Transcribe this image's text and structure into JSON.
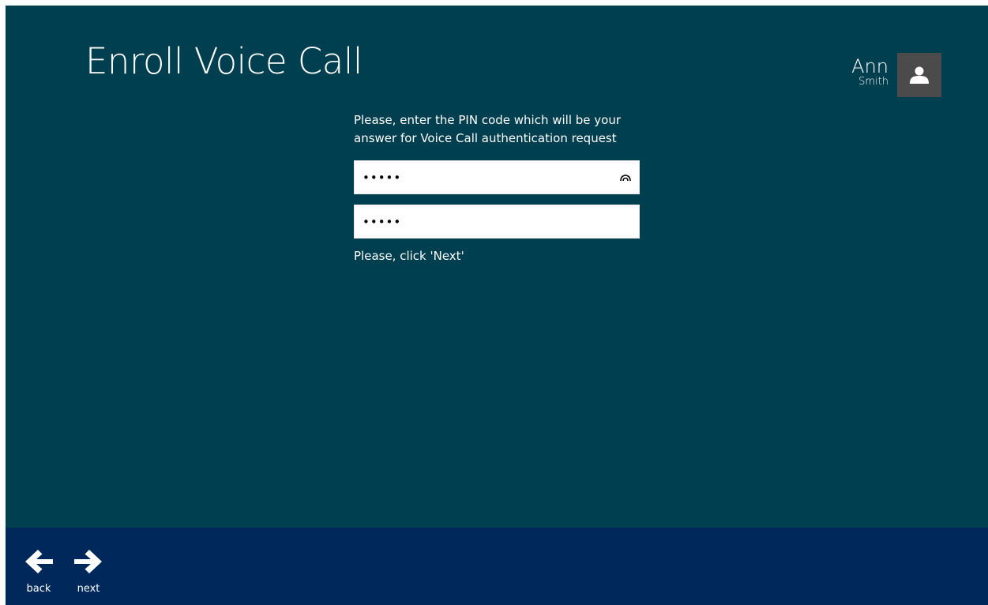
{
  "header": {
    "title": "Enroll Voice Call"
  },
  "user": {
    "first_name": "Ann",
    "last_name": "Smith",
    "avatar_icon": "person-icon",
    "avatar_color": "#4b4b4b"
  },
  "form": {
    "instruction": "Please, enter the PIN code which will be your answer for Voice Call authentication request",
    "pin_value": "•••••",
    "pin_confirm_value": "•••••",
    "reveal_icon": "eye-icon",
    "status": "Please, click 'Next'"
  },
  "appbar": {
    "back_label": "back",
    "back_icon": "arrow-left-icon",
    "next_label": "next",
    "next_icon": "arrow-right-icon"
  },
  "colors": {
    "background": "#003f4f",
    "appbar": "#00285a",
    "text": "#ffffff"
  }
}
